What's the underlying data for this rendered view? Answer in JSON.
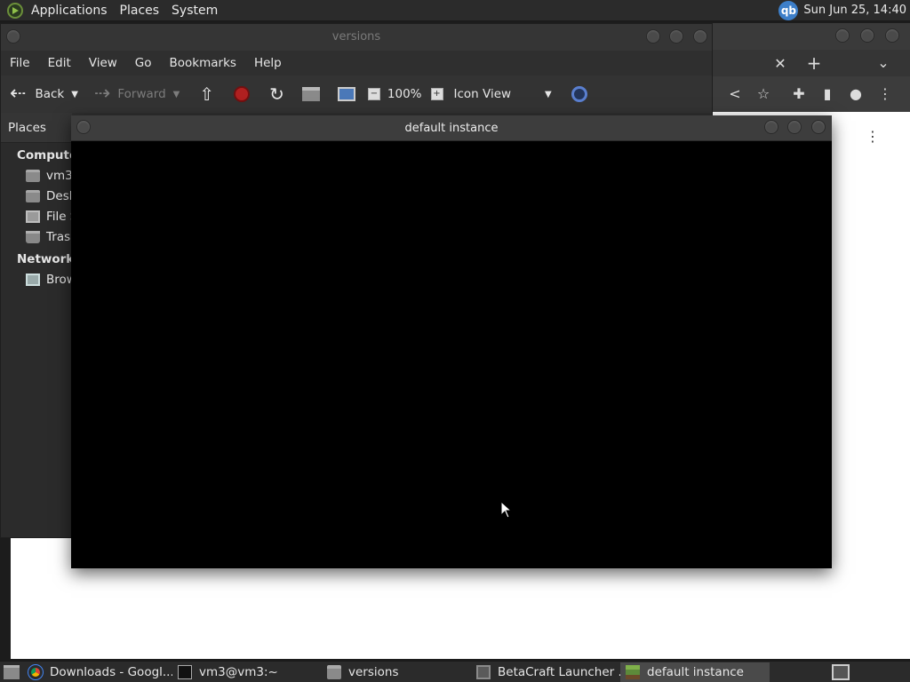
{
  "top_panel": {
    "menu": [
      "Applications",
      "Places",
      "System"
    ],
    "user_badge": "qb",
    "clock": "Sun Jun 25, 14:40"
  },
  "file_manager": {
    "title": "versions",
    "menu": [
      "File",
      "Edit",
      "View",
      "Go",
      "Bookmarks",
      "Help"
    ],
    "toolbar": {
      "back": "Back",
      "forward": "Forward",
      "zoom": "100%",
      "view_mode": "Icon View"
    },
    "sidebar": {
      "header": "Places",
      "sections": [
        {
          "title": "Computer",
          "items": [
            {
              "label": "vm3",
              "icon": "home-folder-icon"
            },
            {
              "label": "Desktop",
              "icon": "desktop-icon"
            },
            {
              "label": "File System",
              "icon": "drive-icon"
            },
            {
              "label": "Trash",
              "icon": "trash-icon"
            }
          ]
        },
        {
          "title": "Network",
          "items": [
            {
              "label": "Browse Network",
              "icon": "network-icon"
            }
          ]
        }
      ]
    }
  },
  "game_window": {
    "title": "default instance"
  },
  "taskbar": {
    "tasks": [
      {
        "label": "Downloads - Googl...",
        "icon": "chrome-icon",
        "active": false
      },
      {
        "label": "vm3@vm3:~",
        "icon": "terminal-icon",
        "active": false
      },
      {
        "label": "versions",
        "icon": "folder-icon",
        "active": false
      },
      {
        "label": "BetaCraft Launcher ...",
        "icon": "betacraft-icon",
        "active": false
      },
      {
        "label": "default instance",
        "icon": "minecraft-icon",
        "active": true
      }
    ]
  }
}
